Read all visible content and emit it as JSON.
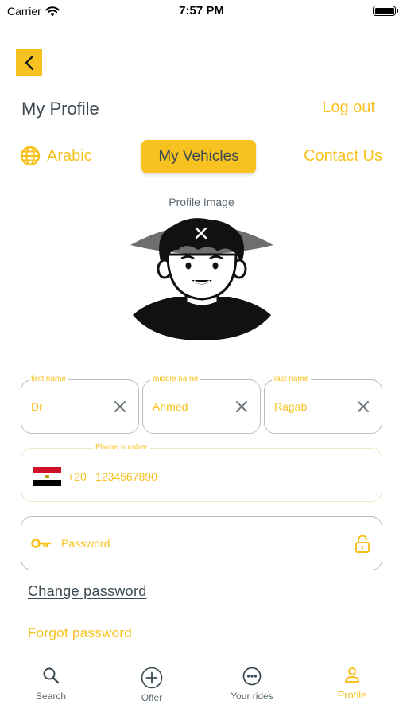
{
  "status_bar": {
    "carrier": "Carrier",
    "time": "7:57 PM"
  },
  "header": {
    "title": "My Profile",
    "logout_label": "Log out"
  },
  "actions": {
    "language_label": "Arabic",
    "vehicles_label": "My Vehicles",
    "contact_label": "Contact Us"
  },
  "profile_image": {
    "label": "Profile Image"
  },
  "form": {
    "first_name": {
      "label": "first name",
      "value": "Dr"
    },
    "middle_name": {
      "label": "middle name",
      "value": "Ahmed"
    },
    "last_name": {
      "label": "last name",
      "value": "Ragab"
    },
    "phone": {
      "label": "Phone number",
      "country_code": "+20",
      "value": "1234567890",
      "flag_icon": "egypt-flag-icon"
    },
    "password": {
      "placeholder": "Password"
    }
  },
  "links": {
    "change_password": "Change password",
    "forgot_password": "Forgot password"
  },
  "tab_bar": {
    "tabs": [
      {
        "label": "Search",
        "icon": "search-icon",
        "active": false
      },
      {
        "label": "Offer",
        "icon": "plus-circle-icon",
        "active": false
      },
      {
        "label": "Your rides",
        "icon": "more-circle-icon",
        "active": false
      },
      {
        "label": "Profile",
        "icon": "person-icon",
        "active": true
      }
    ]
  },
  "colors": {
    "accent": "#f7c21f",
    "text": "#3d4a52",
    "border": "#b9bec2"
  }
}
